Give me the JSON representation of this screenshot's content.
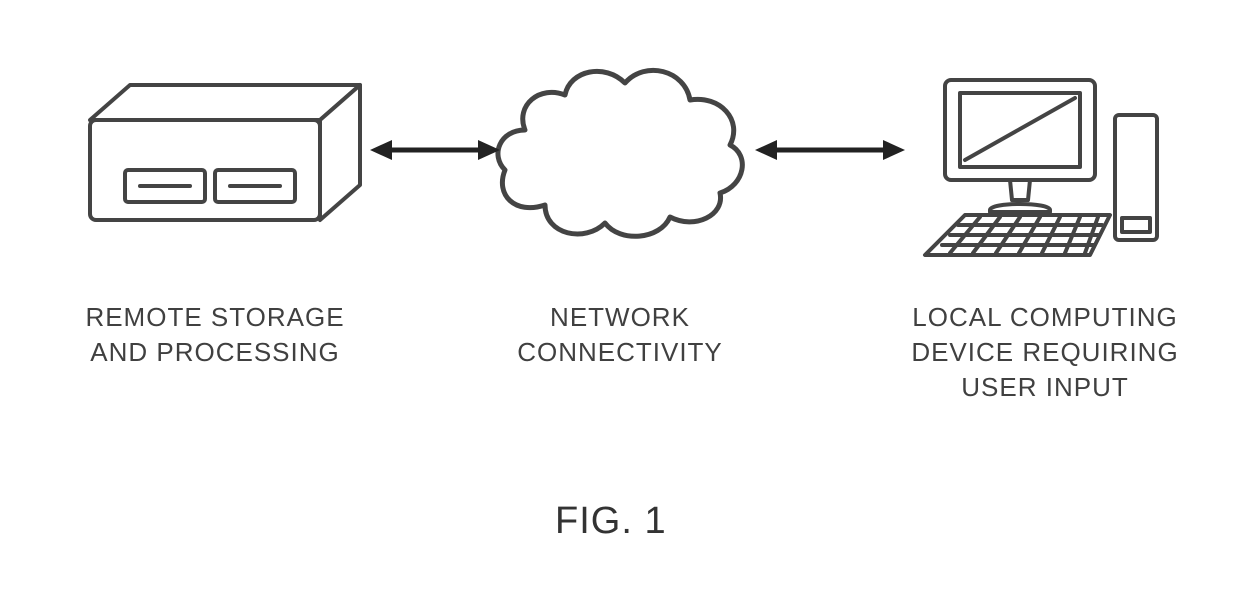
{
  "figure_label": "FIG. 1",
  "nodes": {
    "server": {
      "label": "REMOTE STORAGE\nAND PROCESSING"
    },
    "cloud": {
      "label": "NETWORK\nCONNECTIVITY"
    },
    "client": {
      "label": "LOCAL COMPUTING\nDEVICE REQUIRING\nUSER INPUT"
    }
  }
}
